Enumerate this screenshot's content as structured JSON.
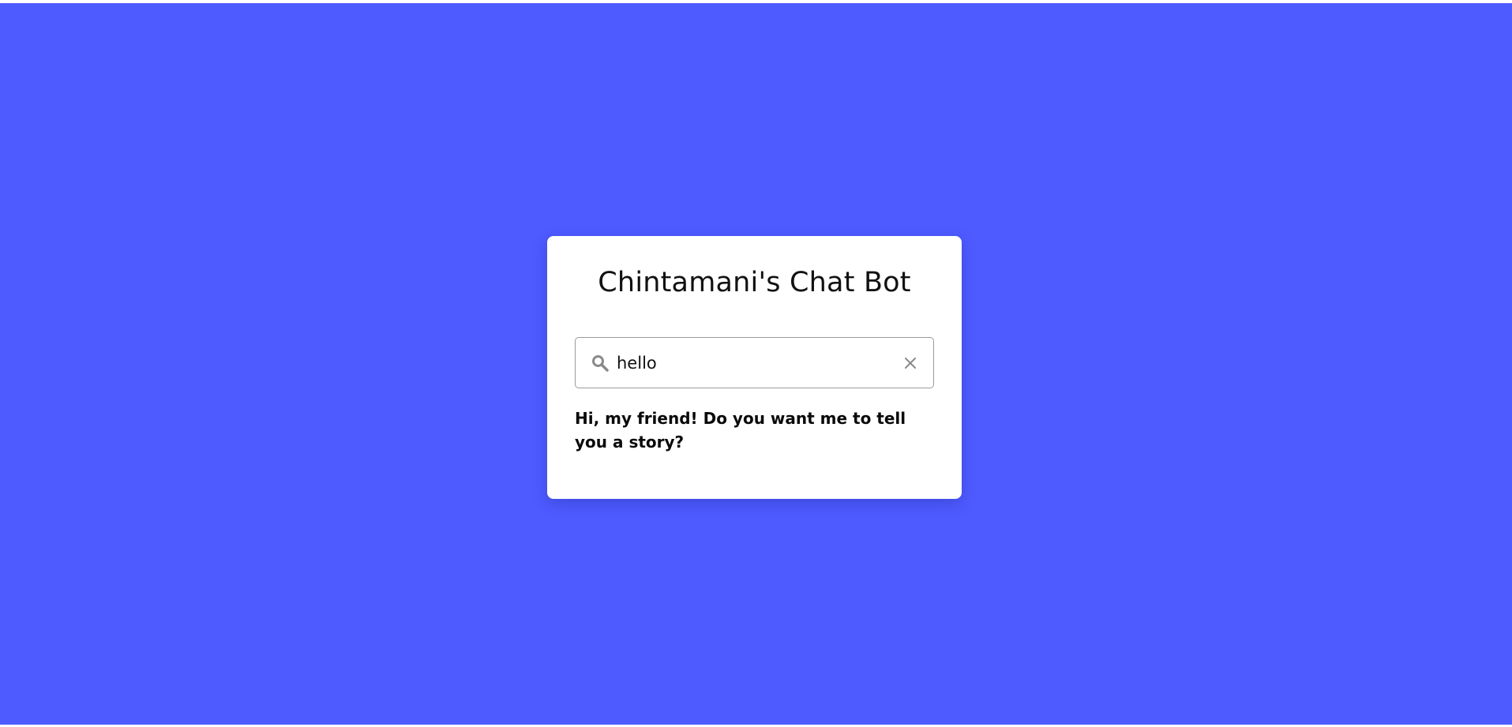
{
  "page": {
    "background_color": "#4e5bff"
  },
  "card": {
    "title": "Chintamani's Chat Bot"
  },
  "search": {
    "value": "hello",
    "placeholder": "",
    "icon": "search-icon",
    "clear_icon": "close-icon"
  },
  "response": {
    "text": "Hi, my friend! Do you want me to tell you a story?"
  }
}
